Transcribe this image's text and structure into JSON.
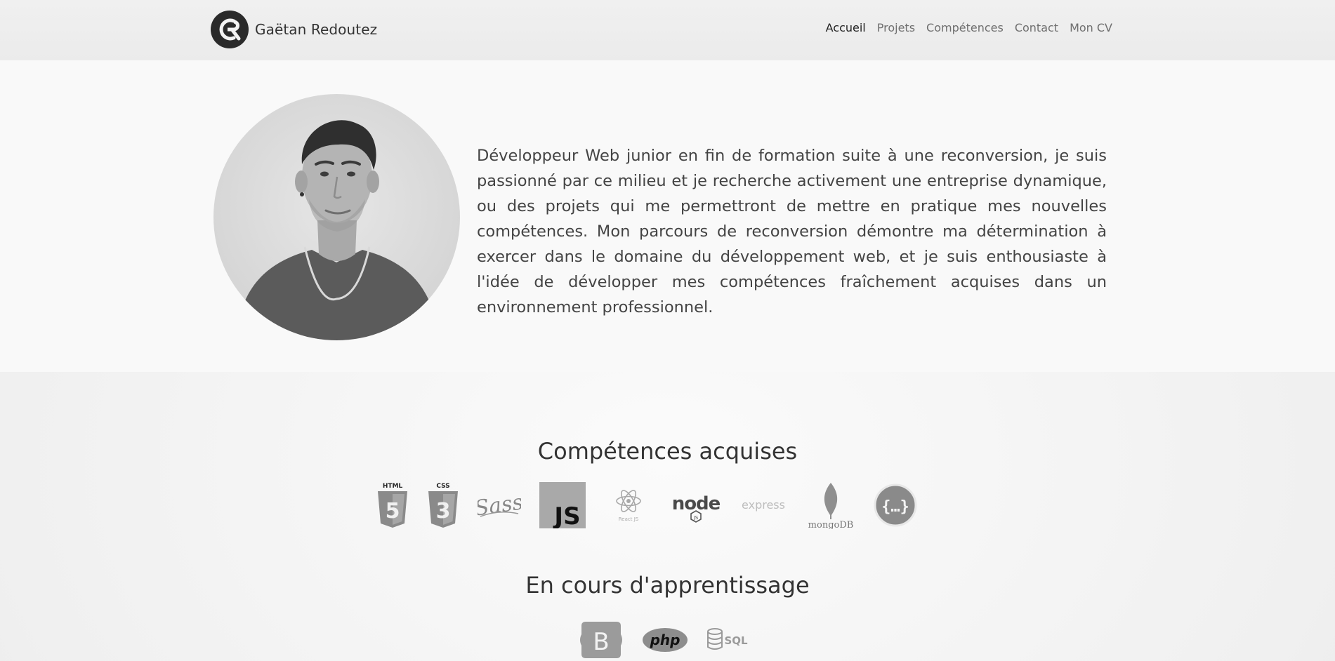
{
  "header": {
    "brand_name": "Gaëtan Redoutez",
    "logo_icon": "gr-monogram-logo",
    "nav": [
      {
        "label": "Accueil",
        "active": true
      },
      {
        "label": "Projets",
        "active": false
      },
      {
        "label": "Compétences",
        "active": false
      },
      {
        "label": "Contact",
        "active": false
      },
      {
        "label": "Mon CV",
        "active": false
      }
    ]
  },
  "hero": {
    "photo": "profile-photo",
    "bio": "Développeur Web junior en fin de formation suite à une reconversion, je suis passionné par ce milieu et je recherche activement une entreprise dynamique, ou des projets qui me permettront de mettre en pratique mes nouvelles compétences. Mon parcours de reconversion démontre ma détermination à exercer dans le domaine du développement web, et je suis enthousiaste à l'idée de développer mes compétences fraîchement acquises dans un environnement professionnel."
  },
  "skills": {
    "acquired_title": "Compétences acquises",
    "acquired": [
      {
        "icon": "html5-icon",
        "label": "HTML"
      },
      {
        "icon": "css3-icon",
        "label": "CSS"
      },
      {
        "icon": "sass-icon",
        "label": "Sass"
      },
      {
        "icon": "javascript-icon",
        "label": "JS"
      },
      {
        "icon": "react-icon",
        "label": "React JS"
      },
      {
        "icon": "nodejs-icon",
        "label": "node"
      },
      {
        "icon": "express-icon",
        "label": "express"
      },
      {
        "icon": "mongodb-icon",
        "label": "mongoDB"
      },
      {
        "icon": "swagger-icon",
        "label": "{...}"
      }
    ],
    "learning_title": "En cours d'apprentissage",
    "learning": [
      {
        "icon": "bootstrap-icon",
        "label": "B"
      },
      {
        "icon": "php-icon",
        "label": "php"
      },
      {
        "icon": "sql-icon",
        "label": "SQL"
      }
    ]
  },
  "colors": {
    "header_bg": "#ececec",
    "hero_bg": "#f9f9f9",
    "page_bg": "#f1f1f1",
    "text": "#333333",
    "nav_inactive": "#6f6f6f"
  }
}
